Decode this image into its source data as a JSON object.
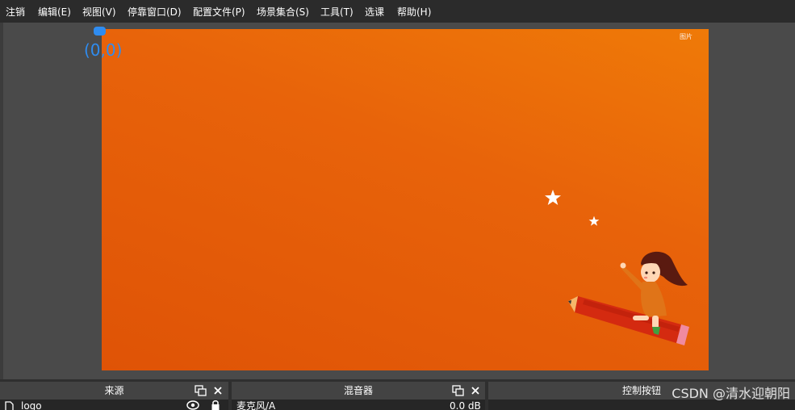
{
  "menu": {
    "items": [
      {
        "label": "注销"
      },
      {
        "label": "编辑(E)"
      },
      {
        "label": "视图(V)"
      },
      {
        "label": "停靠窗口(D)"
      },
      {
        "label": "配置文件(P)"
      },
      {
        "label": "场景集合(S)"
      },
      {
        "label": "工具(T)"
      },
      {
        "label": "选课"
      },
      {
        "label": "帮助(H)"
      }
    ]
  },
  "preview": {
    "origin_label": "(0,0)",
    "corner_logo": "图片",
    "accent_color": "#2f8cf0",
    "canvas_colors": [
      "#ef7a08",
      "#df5306"
    ]
  },
  "docks": {
    "sources": {
      "title": "来源",
      "first_item": "logo"
    },
    "mixer": {
      "title": "混音器",
      "first_item": "麦克风/A",
      "level": "0.0 dB"
    },
    "controls": {
      "title": "控制按钮"
    }
  },
  "watermark": "CSDN @清水迎朝阳"
}
